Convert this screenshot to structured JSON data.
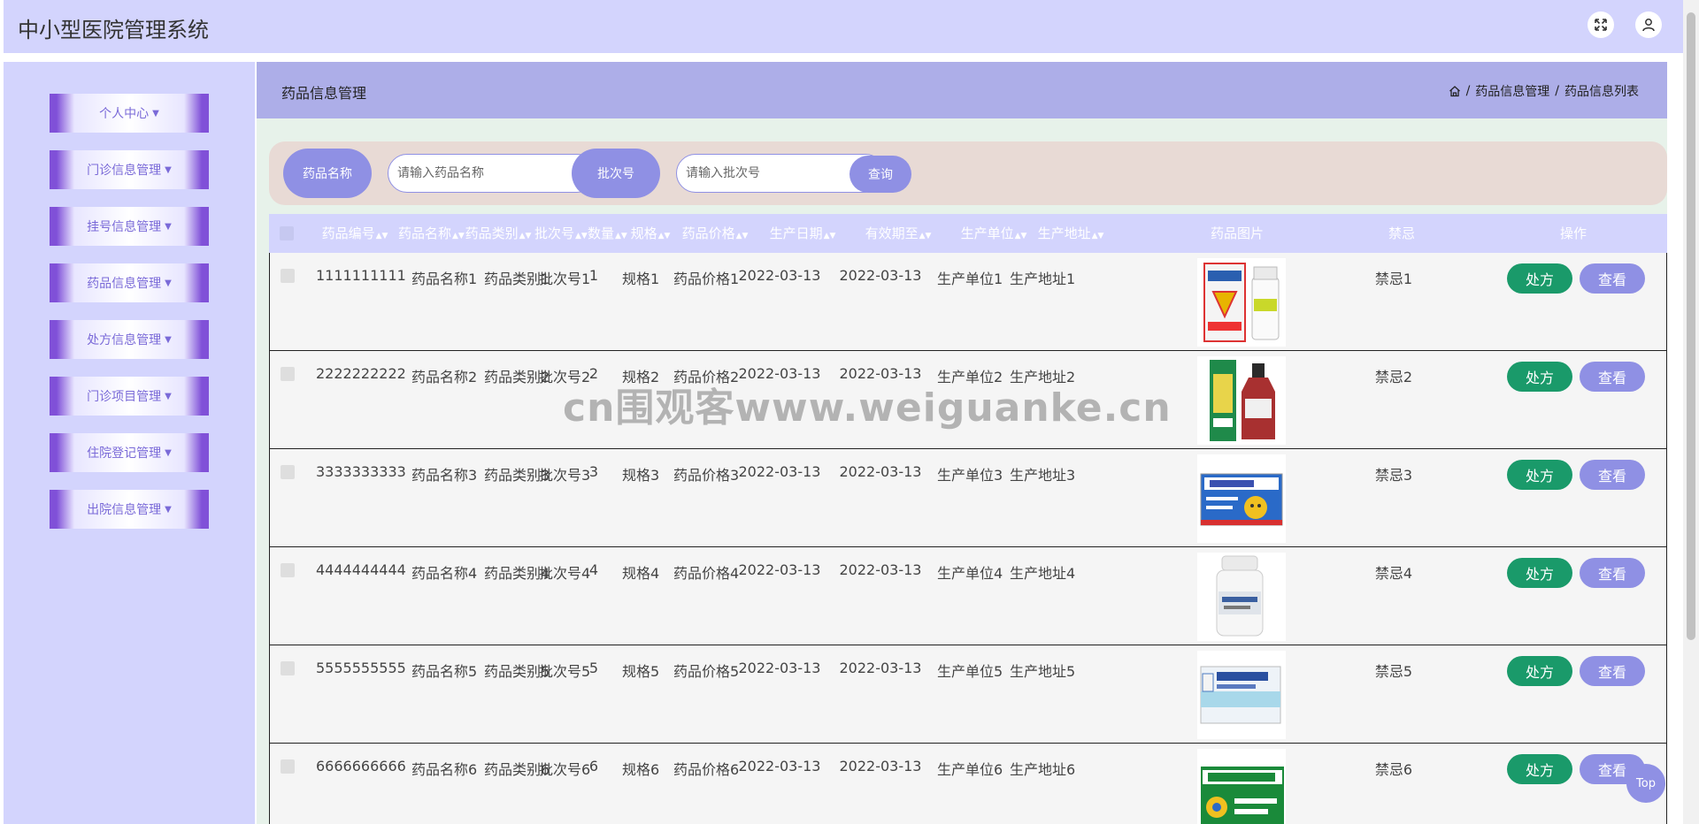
{
  "app": {
    "title": "中小型医院管理系统"
  },
  "header": {
    "fullscreen_icon": "fullscreen-icon",
    "user_icon": "user-icon"
  },
  "sidebar": {
    "items": [
      {
        "label": "个人中心"
      },
      {
        "label": "门诊信息管理"
      },
      {
        "label": "挂号信息管理"
      },
      {
        "label": "药品信息管理"
      },
      {
        "label": "处方信息管理"
      },
      {
        "label": "门诊项目管理"
      },
      {
        "label": "住院登记管理"
      },
      {
        "label": "出院信息管理"
      }
    ]
  },
  "page": {
    "title": "药品信息管理",
    "breadcrumb": {
      "icon": "home-icon",
      "items": [
        "药品信息管理",
        "药品信息列表"
      ],
      "separator": "/"
    }
  },
  "search": {
    "name_label": "药品名称",
    "name_placeholder": "请输入药品名称",
    "batch_label": "批次号",
    "batch_placeholder": "请输入批次号",
    "query_label": "查询"
  },
  "table": {
    "columns": [
      "药品编号",
      "药品名称",
      "药品类别",
      "批次号",
      "数量",
      "规格",
      "药品价格",
      "生产日期",
      "有效期至",
      "生产单位",
      "生产地址",
      "药品图片",
      "禁忌",
      "操作"
    ],
    "rows": [
      {
        "code": "1111111111",
        "name": "药品名称1",
        "category": "药品类别1",
        "batch": "批次号1",
        "qty": "1",
        "spec": "规格1",
        "price": "药品价格1",
        "prod_date": "2022-03-13",
        "expiry": "2022-03-13",
        "maker": "生产单位1",
        "address": "生产地址1",
        "contra": "禁忌1"
      },
      {
        "code": "2222222222",
        "name": "药品名称2",
        "category": "药品类别2",
        "batch": "批次号2",
        "qty": "2",
        "spec": "规格2",
        "price": "药品价格2",
        "prod_date": "2022-03-13",
        "expiry": "2022-03-13",
        "maker": "生产单位2",
        "address": "生产地址2",
        "contra": "禁忌2"
      },
      {
        "code": "3333333333",
        "name": "药品名称3",
        "category": "药品类别3",
        "batch": "批次号3",
        "qty": "3",
        "spec": "规格3",
        "price": "药品价格3",
        "prod_date": "2022-03-13",
        "expiry": "2022-03-13",
        "maker": "生产单位3",
        "address": "生产地址3",
        "contra": "禁忌3"
      },
      {
        "code": "4444444444",
        "name": "药品名称4",
        "category": "药品类别4",
        "batch": "批次号4",
        "qty": "4",
        "spec": "规格4",
        "price": "药品价格4",
        "prod_date": "2022-03-13",
        "expiry": "2022-03-13",
        "maker": "生产单位4",
        "address": "生产地址4",
        "contra": "禁忌4"
      },
      {
        "code": "5555555555",
        "name": "药品名称5",
        "category": "药品类别5",
        "batch": "批次号5",
        "qty": "5",
        "spec": "规格5",
        "price": "药品价格5",
        "prod_date": "2022-03-13",
        "expiry": "2022-03-13",
        "maker": "生产单位5",
        "address": "生产地址5",
        "contra": "禁忌5"
      },
      {
        "code": "6666666666",
        "name": "药品名称6",
        "category": "药品类别6",
        "batch": "批次号6",
        "qty": "6",
        "spec": "规格6",
        "price": "药品价格6",
        "prod_date": "2022-03-13",
        "expiry": "2022-03-13",
        "maker": "生产单位6",
        "address": "生产地址6",
        "contra": "禁忌6"
      }
    ],
    "actions": {
      "prescribe": "处方",
      "view": "查看"
    }
  },
  "watermark": "cn围观客www.weiguanke.cn",
  "top_button": "Top",
  "colors": {
    "header_bg": "#d3d4fd",
    "crumbbar_bg": "#adaee8",
    "accent": "#8f90e4",
    "sidebar_border": "#8050d8",
    "prescribe_btn": "#1a9a6a",
    "main_bg": "#e7f2ea",
    "search_bg": "#e8dad5"
  }
}
